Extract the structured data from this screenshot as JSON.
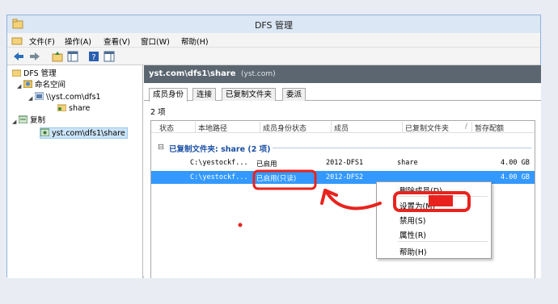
{
  "window": {
    "title": "DFS 管理"
  },
  "menu": [
    "文件(F)",
    "操作(A)",
    "查看(V)",
    "窗口(W)",
    "帮助(H)"
  ],
  "tree": {
    "root": "DFS 管理",
    "namespace": "命名空间",
    "namespace_item": "\\\\yst.com\\dfs1",
    "share": "share",
    "replication": "复制",
    "replication_item": "yst.com\\dfs1\\share"
  },
  "content": {
    "header_main": "yst.com\\dfs1\\share",
    "header_sub": "(yst.com)",
    "tabs": [
      "成员身份",
      "连接",
      "已复制文件夹",
      "委派"
    ],
    "item_count": "2 项",
    "columns": [
      "状态",
      "本地路径",
      "成员身份状态",
      "成员",
      "已复制文件夹",
      "暂存配额"
    ],
    "sort_indicator": "/",
    "group_label": "已复制文件夹: share (2 项)",
    "group_toggle": "⊟",
    "rows": [
      {
        "path": "C:\\yestockf...",
        "status": "已启用",
        "member": "2012-DFS1",
        "folder": "share",
        "quota": "4.00 GB"
      },
      {
        "path": "C:\\yestockf...",
        "status": "已启用(只读)",
        "member": "2012-DFS2",
        "folder": "",
        "quota": "4.00 GB"
      }
    ]
  },
  "context_menu": {
    "items": [
      "删除成员(D)",
      "设置为(M)",
      "禁用(S)",
      "属性(R)",
      "帮助(H)"
    ]
  },
  "colors": {
    "selection": "#3399ff",
    "annotation": "#e8231e",
    "content_header": "#5b6670"
  }
}
